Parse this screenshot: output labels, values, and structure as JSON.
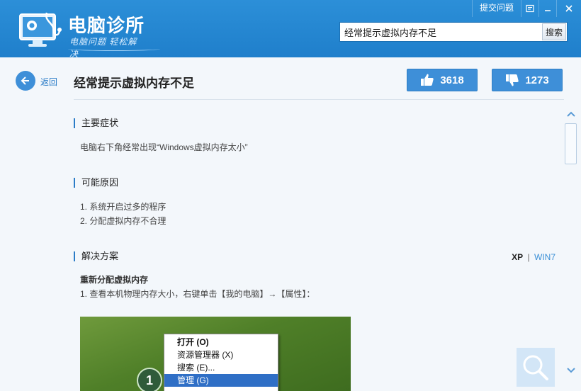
{
  "app": {
    "title": "电脑诊所",
    "slogan": "电脑问题 轻松解决"
  },
  "topbar": {
    "submit_label": "提交问题"
  },
  "search": {
    "value": "经常提示虚拟内存不足",
    "button_label": "搜索"
  },
  "header": {
    "back_label": "返回",
    "title": "经常提示虚拟内存不足",
    "likes": "3618",
    "dislikes": "1273"
  },
  "sections": {
    "symptoms": {
      "heading": "主要症状",
      "text": "电脑右下角经常出现“Windows虚拟内存太小”"
    },
    "causes": {
      "heading": "可能原因",
      "items": [
        "1. 系统开启过多的程序",
        "2. 分配虚拟内存不合理"
      ]
    },
    "solution": {
      "heading": "解决方案",
      "os_xp": "XP",
      "os_sep": "|",
      "os_win7": "WIN7",
      "subheading": "重新分配虚拟内存",
      "step1": "1. 查看本机物理内存大小，右键单击【我的电脑】→【属性】："
    }
  },
  "screenshot": {
    "step_number": "1",
    "menu_items": [
      "打开 (O)",
      "资源管理器 (X)",
      "搜索 (E)...",
      "管理 (G)"
    ]
  },
  "colors": {
    "titlebar": "#1f7fcb",
    "accent": "#3e8fd8",
    "link": "#3a8fd6"
  }
}
